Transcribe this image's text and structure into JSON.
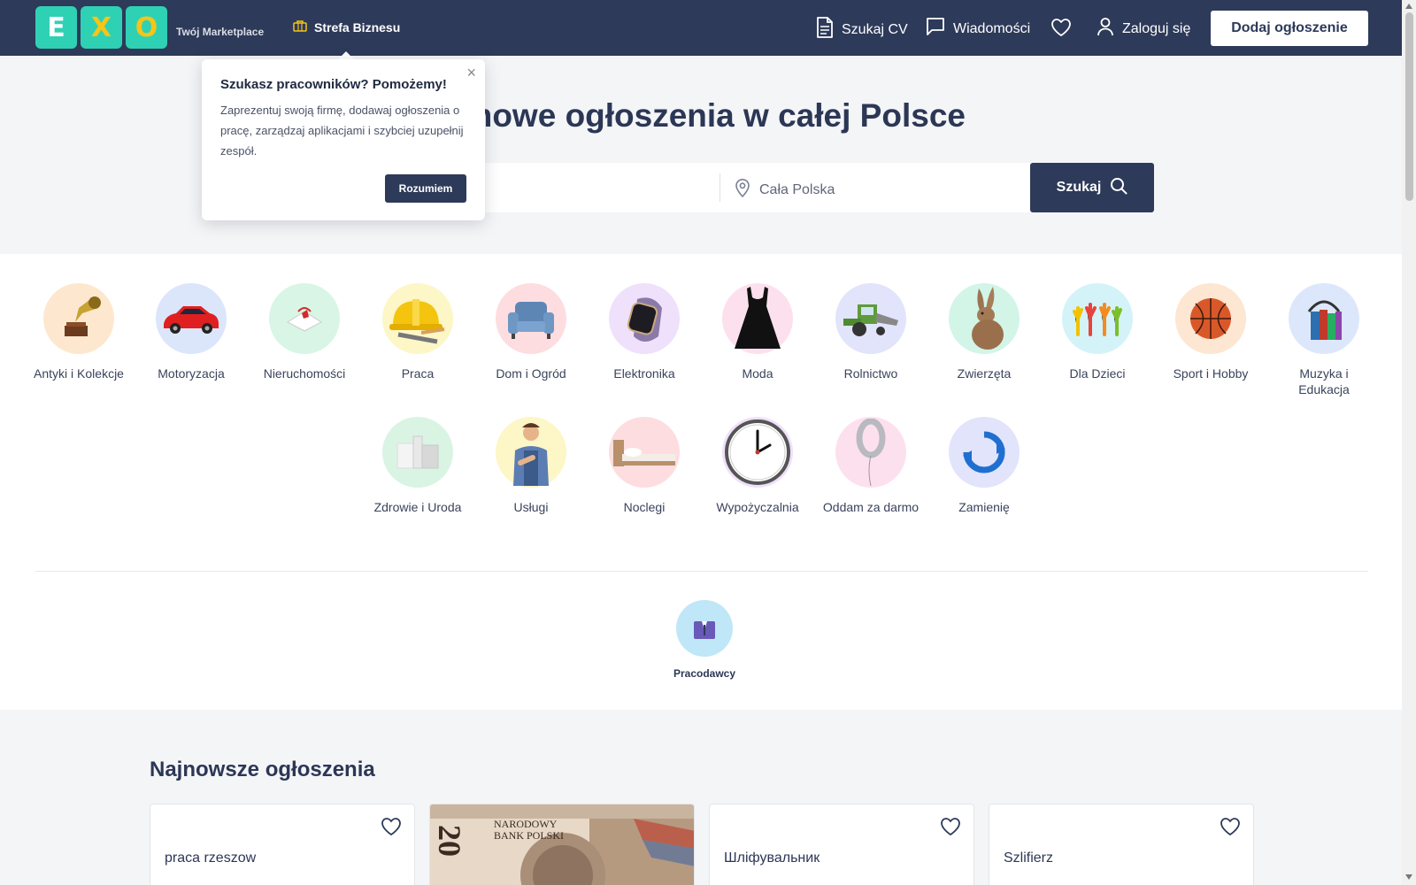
{
  "header": {
    "logo_letters": [
      "E",
      "X",
      "O"
    ],
    "tagline": "Twój Marketplace",
    "business_zone": "Strefa Biznesu",
    "search_cv": "Szukaj CV",
    "messages": "Wiadomości",
    "login": "Zaloguj się",
    "add_listing": "Dodaj ogłoszenie",
    "colors": {
      "background": "#2d3a59",
      "logo_tile": "#2fd1b4",
      "logo_accent": "#f5c518"
    }
  },
  "popup": {
    "title": "Szukasz pracowników? Pomożemy!",
    "body": "Zaprezentuj swoją firmę, dodawaj ogłoszenia o pracę, zarządzaj aplikacjami i szybciej uzupełnij zespół.",
    "button": "Rozumiem",
    "close": "×"
  },
  "hero": {
    "title_visible": "rmowe ogłoszenia w całej Polsce",
    "location": "Cała Polska",
    "search_button": "Szukaj"
  },
  "categories": [
    {
      "label": "Antyki i Kolekcje",
      "icon": "gramophone-icon",
      "bg": "#fde8cf"
    },
    {
      "label": "Motoryzacja",
      "icon": "car-icon",
      "bg": "#dbe6fb"
    },
    {
      "label": "Nieruchomości",
      "icon": "house-keys-icon",
      "bg": "#d9f5e6"
    },
    {
      "label": "Praca",
      "icon": "hard-hat-icon",
      "bg": "#fdf6c6"
    },
    {
      "label": "Dom i Ogród",
      "icon": "armchair-icon",
      "bg": "#fddde0"
    },
    {
      "label": "Elektronika",
      "icon": "smartwatch-icon",
      "bg": "#efe0fb"
    },
    {
      "label": "Moda",
      "icon": "dress-icon",
      "bg": "#fde0ee"
    },
    {
      "label": "Rolnictwo",
      "icon": "harvester-icon",
      "bg": "#e1e4fb"
    },
    {
      "label": "Zwierzęta",
      "icon": "rabbit-icon",
      "bg": "#d2f5e8"
    },
    {
      "label": "Dla Dzieci",
      "icon": "hands-icon",
      "bg": "#d3f3f8"
    },
    {
      "label": "Sport i Hobby",
      "icon": "basketball-icon",
      "bg": "#fde6d2"
    },
    {
      "label": "Muzyka i Edukacja",
      "icon": "books-headphones-icon",
      "bg": "#dde7fb"
    },
    {
      "label": "Zdrowie i Uroda",
      "icon": "cosmetics-icon",
      "bg": "#daf4e4"
    },
    {
      "label": "Usługi",
      "icon": "handyman-icon",
      "bg": "#fdf6c6"
    },
    {
      "label": "Noclegi",
      "icon": "bed-icon",
      "bg": "#fddde0"
    },
    {
      "label": "Wypożyczalnia",
      "icon": "clock-icon",
      "bg": "#efe0fb"
    },
    {
      "label": "Oddam za darmo",
      "icon": "balloon-zero-icon",
      "bg": "#fde0ee"
    },
    {
      "label": "Zamienię",
      "icon": "exchange-icon",
      "bg": "#e1e4fb"
    }
  ],
  "employers": {
    "label": "Pracodawcy",
    "icon": "suit-icon"
  },
  "latest": {
    "title": "Najnowsze ogłoszenia",
    "cards": [
      {
        "title": "praca rzeszow"
      },
      {
        "title": "",
        "image": "banknote-image",
        "banknote_text": "NARODOWY BANK POLSKI",
        "banknote_value": "20"
      },
      {
        "title": "Шліфувальник"
      },
      {
        "title": "Szlifierz"
      }
    ]
  }
}
